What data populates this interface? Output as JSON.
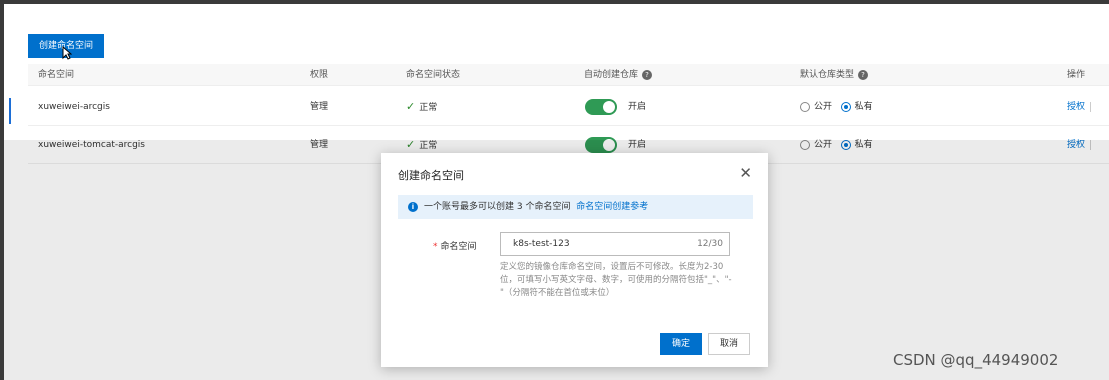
{
  "toolbar": {
    "create_label": "创建命名空间"
  },
  "table": {
    "headers": {
      "name": "命名空间",
      "permission": "权限",
      "status": "命名空间状态",
      "auto_create": "自动创建仓库",
      "default_type": "默认仓库类型",
      "actions": "操作"
    },
    "rows": [
      {
        "name": "xuweiwei-arcgis",
        "permission": "管理",
        "status": "正常",
        "auto_create": "开启",
        "public_label": "公开",
        "private_label": "私有",
        "default_type": "私有",
        "action": "授权"
      },
      {
        "name": "xuweiwei-tomcat-arcgis",
        "permission": "管理",
        "status": "正常",
        "auto_create": "开启",
        "public_label": "公开",
        "private_label": "私有",
        "default_type": "私有",
        "action": "授权"
      }
    ]
  },
  "modal": {
    "title": "创建命名空间",
    "notice_text": "一个账号最多可以创建 3 个命名空间",
    "notice_link": "命名空间创建参考",
    "field_label": "命名空间",
    "field_value": "k8s-test-123",
    "field_count": "12/30",
    "help_text": "定义您的镜像仓库命名空间，设置后不可修改。长度为2-30位，可填写小写英文字母、数字，可使用的分隔符包括\"_\"、\"-\"（分隔符不能在首位或末位）",
    "ok_label": "确定",
    "cancel_label": "取消"
  },
  "watermark": {
    "csdn": "CSDN @qq_44949002"
  },
  "colors": {
    "primary": "#0070cc",
    "toggle_on": "#2f9a55",
    "success": "#2e8b2e"
  }
}
